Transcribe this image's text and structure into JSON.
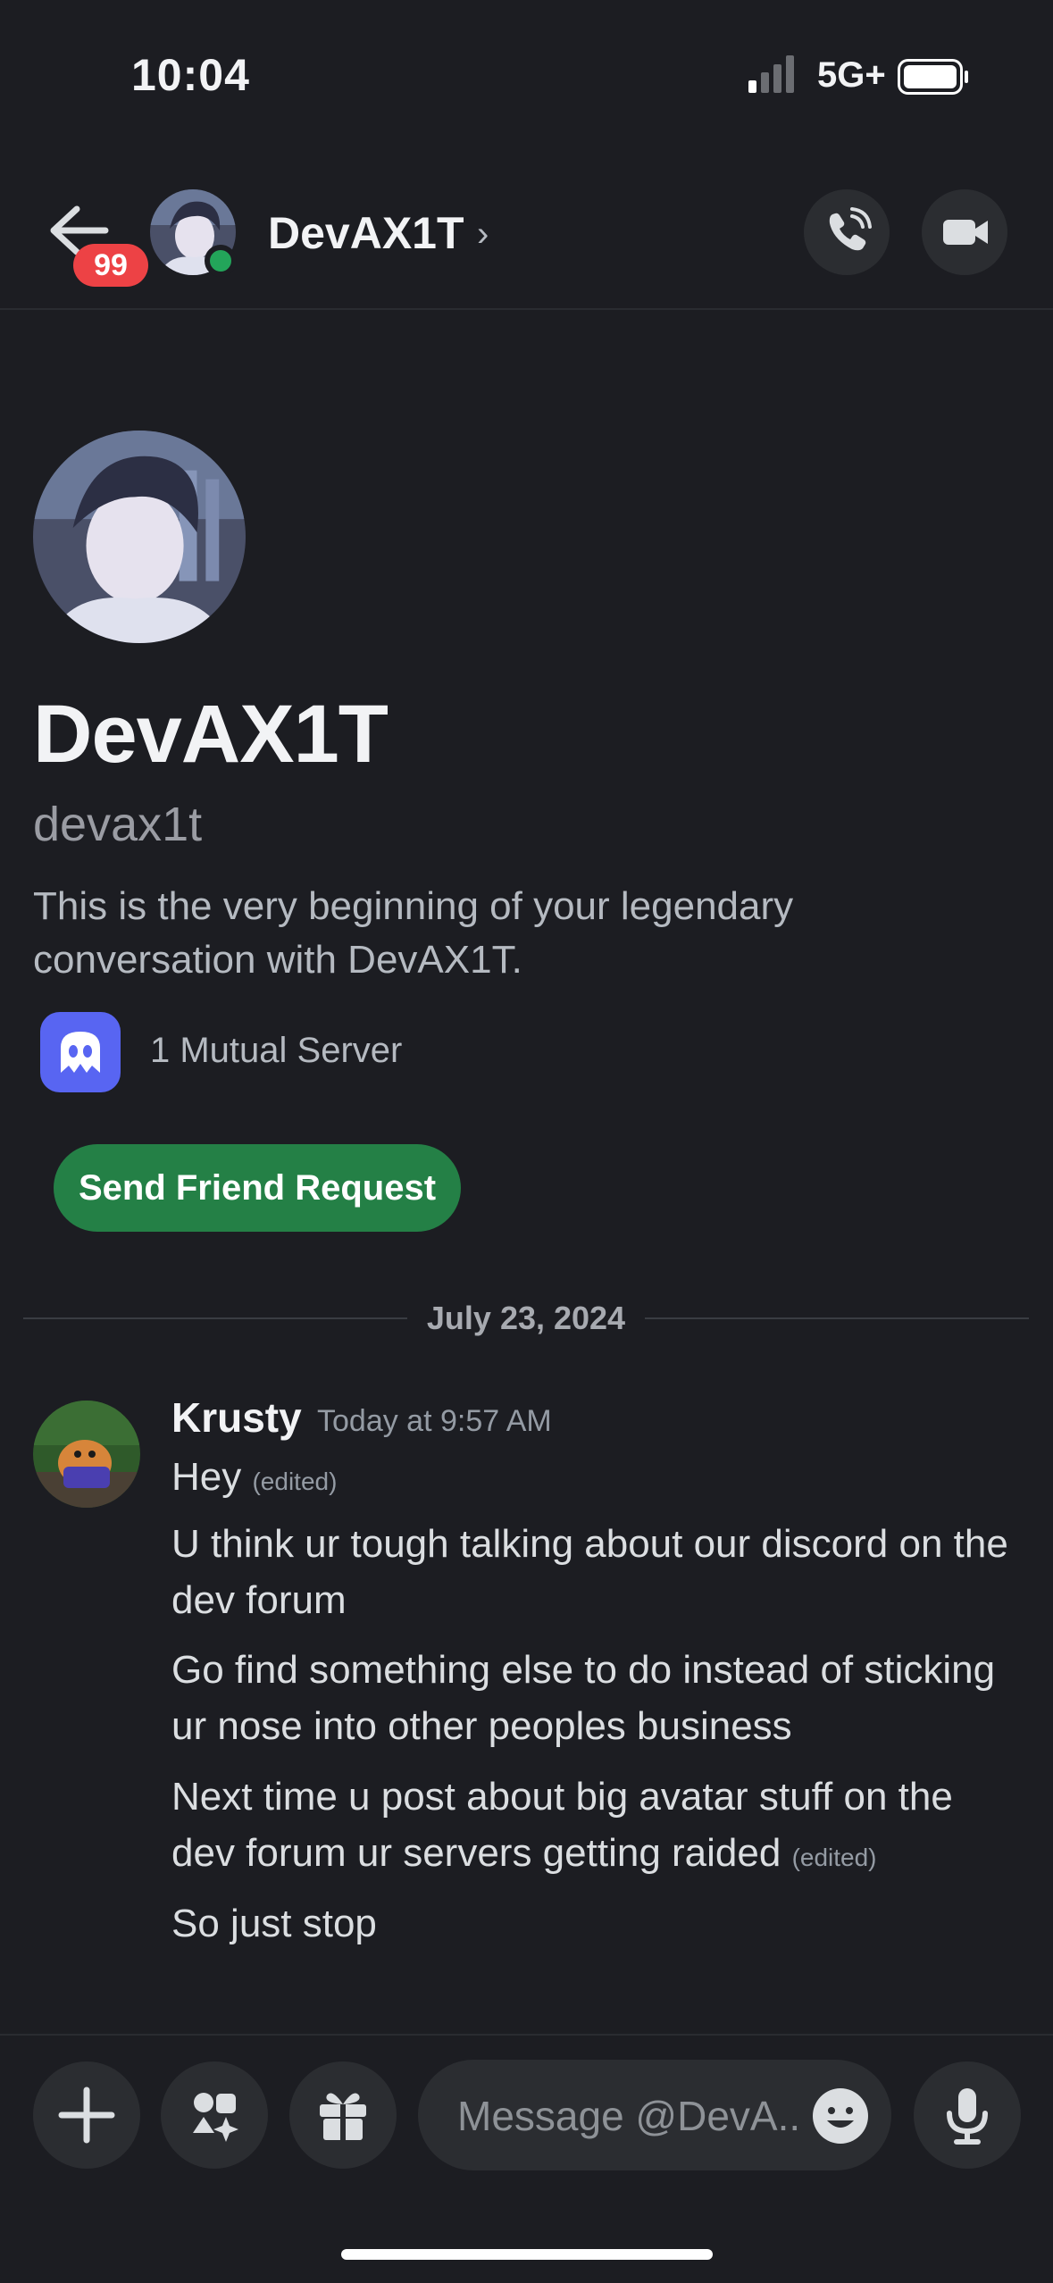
{
  "status_bar": {
    "time": "10:04",
    "network": "5G+"
  },
  "header": {
    "badge_count": "99",
    "name": "DevAX1T",
    "chevron": "›"
  },
  "profile": {
    "display_name": "DevAX1T",
    "username": "devax1t",
    "intro": "This is the very beginning of your legendary conversation with DevAX1T.",
    "mutual_servers": "1 Mutual Server",
    "friend_button": "Send Friend Request"
  },
  "divider": {
    "date": "July 23, 2024"
  },
  "message": {
    "author": "Krusty",
    "timestamp": "Today at 9:57 AM",
    "lines": [
      {
        "text": "Hey",
        "edited": "(edited)"
      },
      {
        "text": "U think ur tough talking about our discord on the dev forum"
      },
      {
        "text": "Go find something else to do instead of sticking ur nose into other peoples business"
      },
      {
        "text": "Next time u post about big avatar stuff on the dev forum ur servers getting raided",
        "edited": "(edited)"
      },
      {
        "text": "So just stop"
      }
    ]
  },
  "composer": {
    "placeholder": "Message @DevA..."
  },
  "colors": {
    "online": "#23a55a",
    "badge": "#ed4245",
    "friend_button": "#248046",
    "blurple": "#5865f2"
  },
  "icons": [
    "back-arrow-icon",
    "phone-call-icon",
    "video-camera-icon",
    "plus-icon",
    "apps-icon",
    "gift-icon",
    "emoji-icon",
    "microphone-icon",
    "discord-server-icon"
  ]
}
